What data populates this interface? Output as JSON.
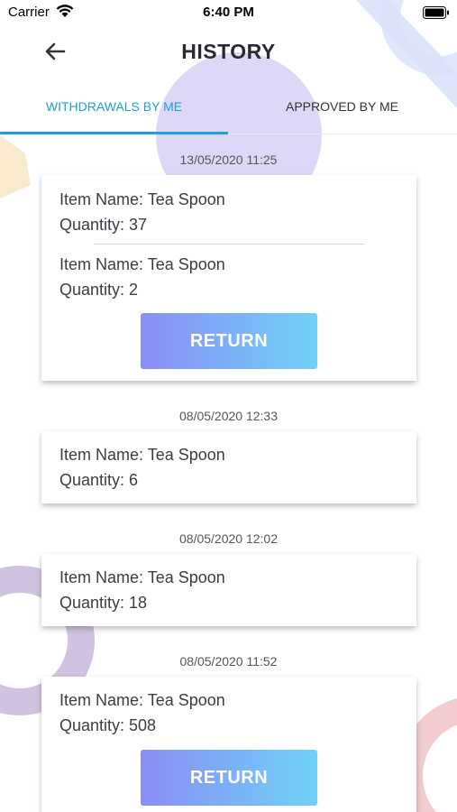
{
  "status_bar": {
    "carrier": "Carrier",
    "time": "6:40 PM",
    "wifi_icon": "wifi-icon",
    "battery_icon": "battery-icon"
  },
  "header": {
    "title": "HISTORY",
    "back_icon": "arrow-left-icon"
  },
  "tabs": [
    {
      "label": "WITHDRAWALS BY ME",
      "active": true
    },
    {
      "label": "APPROVED BY ME",
      "active": false
    }
  ],
  "theme": {
    "accent": "#1a9fd6",
    "button_gradient_start": "#8a8ef5",
    "button_gradient_end": "#6fd1f7"
  },
  "history": [
    {
      "date": "13/05/2020 11:25",
      "items": [
        {
          "name": "Item Name: Tea Spoon",
          "quantity": "Quantity: 37"
        },
        {
          "name": "Item Name: Tea Spoon",
          "quantity": "Quantity: 2"
        }
      ],
      "action": "RETURN"
    },
    {
      "date": "08/05/2020 12:33",
      "items": [
        {
          "name": "Item Name: Tea Spoon",
          "quantity": "Quantity: 6"
        }
      ]
    },
    {
      "date": "08/05/2020 12:02",
      "items": [
        {
          "name": "Item Name: Tea Spoon",
          "quantity": "Quantity: 18"
        }
      ]
    },
    {
      "date": "08/05/2020 11:52",
      "items": [
        {
          "name": "Item Name: Tea Spoon",
          "quantity": "Quantity: 508"
        }
      ],
      "action": "RETURN"
    }
  ]
}
